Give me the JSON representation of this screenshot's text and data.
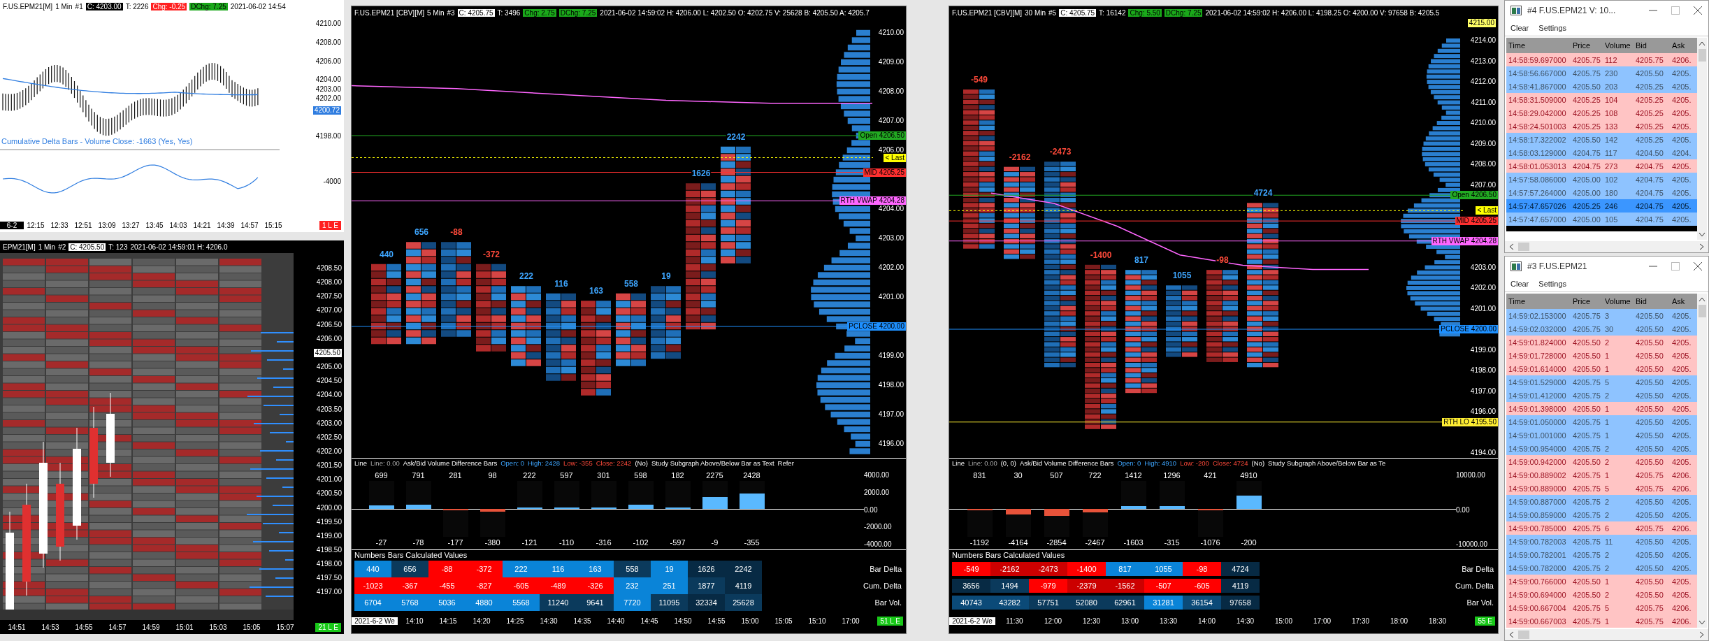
{
  "minute_chart": {
    "header": {
      "symbol": "F.US.EPM21[M]",
      "interval": "1 Min",
      "number": "#1",
      "close": "C: 4203.00",
      "trades": "T: 2226",
      "change": {
        "text": "Chg: -0.25",
        "kind": "down"
      },
      "daily_change": {
        "text": "DChg: 7.25",
        "kind": "up"
      },
      "details": "2021-06-02 14:54"
    },
    "price_labels": [
      {
        "text": "4210.00",
        "kind": "plain"
      },
      {
        "text": "4208.00",
        "kind": "plain"
      },
      {
        "text": "4206.00",
        "kind": "plain"
      },
      {
        "text": "4204.00",
        "kind": "plain"
      },
      {
        "text": "4203.00",
        "kind": "plain"
      },
      {
        "text": "4202.00",
        "kind": "plain"
      },
      {
        "text": "4200.72",
        "kind": "current"
      },
      {
        "text": "4198.00",
        "kind": "plain"
      }
    ],
    "study_label": "Cumulative Delta Bars - Volume  Close: -1663  (Yes, Yes)",
    "study_axis_label": "-4000",
    "time_labels": [
      {
        "text": "6-2",
        "kind": "date"
      },
      {
        "text": "12:15",
        "kind": "time"
      },
      {
        "text": "12:33",
        "kind": "time"
      },
      {
        "text": "12:51",
        "kind": "time"
      },
      {
        "text": "13:09",
        "kind": "time"
      },
      {
        "text": "13:27",
        "kind": "time"
      },
      {
        "text": "13:45",
        "kind": "time"
      },
      {
        "text": "14:03",
        "kind": "time"
      },
      {
        "text": "14:21",
        "kind": "time"
      },
      {
        "text": "14:39",
        "kind": "time"
      },
      {
        "text": "14:57",
        "kind": "time"
      },
      {
        "text": "15:15",
        "kind": "time"
      }
    ],
    "badge": {
      "text": "1 L E",
      "kind": "red"
    }
  },
  "minute_footprint": {
    "header": {
      "symbol": "EPM21[M]",
      "interval": "1 Min",
      "number": "#2",
      "close": "C: 4205.50",
      "trades": "T: 123",
      "details": "2021-06-02 14:59:01 H: 4206.0"
    },
    "price_labels": [
      {
        "text": "4208.50",
        "kind": "plain"
      },
      {
        "text": "4208.00",
        "kind": "plain"
      },
      {
        "text": "4207.50",
        "kind": "plain"
      },
      {
        "text": "4207.00",
        "kind": "plain"
      },
      {
        "text": "4206.50",
        "kind": "plain"
      },
      {
        "text": "4206.00",
        "kind": "plain"
      },
      {
        "text": "4205.50",
        "kind": "current"
      },
      {
        "text": "4205.00",
        "kind": "plain"
      },
      {
        "text": "4204.50",
        "kind": "plain"
      },
      {
        "text": "4204.00",
        "kind": "plain"
      },
      {
        "text": "4203.50",
        "kind": "plain"
      },
      {
        "text": "4203.00",
        "kind": "plain"
      },
      {
        "text": "4202.50",
        "kind": "plain"
      },
      {
        "text": "4202.00",
        "kind": "plain"
      },
      {
        "text": "4201.50",
        "kind": "plain"
      },
      {
        "text": "4201.00",
        "kind": "plain"
      },
      {
        "text": "4200.50",
        "kind": "plain"
      },
      {
        "text": "4200.00",
        "kind": "plain"
      },
      {
        "text": "4199.50",
        "kind": "plain"
      },
      {
        "text": "4199.00",
        "kind": "plain"
      },
      {
        "text": "4198.50",
        "kind": "plain"
      },
      {
        "text": "4198.00",
        "kind": "plain"
      },
      {
        "text": "4197.50",
        "kind": "plain"
      },
      {
        "text": "4197.00",
        "kind": "plain"
      }
    ],
    "time_labels": [
      "14:51",
      "14:53",
      "14:55",
      "14:57",
      "14:59",
      "15:01",
      "15:03",
      "15:05",
      "15:07"
    ],
    "badge": {
      "text": "21 L E",
      "kind": "green"
    }
  },
  "charts": [
    {
      "header": {
        "symbol": "F.US.EPM21 [CBV][M]",
        "interval": "5 Min",
        "number": "#3",
        "close": "C: 4205.75",
        "trades": "T: 3496",
        "change": {
          "text": "Chg: 2.75",
          "kind": "up"
        },
        "daily_change": {
          "text": "DChg: 7.25",
          "kind": "up"
        },
        "details": "2021-06-02 14:59:02 H: 4206.00 L: 4202.50 O: 4202.75 V: 25628 B: 4205.50 A: 4205.7"
      },
      "bar_deltas": [
        {
          "text": "440",
          "kind": "positive"
        },
        {
          "text": "656",
          "kind": "positive"
        },
        {
          "text": "-88",
          "kind": "negative"
        },
        {
          "text": "-372",
          "kind": "negative"
        },
        {
          "text": "222",
          "kind": "positive"
        },
        {
          "text": "116",
          "kind": "positive"
        },
        {
          "text": "163",
          "kind": "positive"
        },
        {
          "text": "558",
          "kind": "positive"
        },
        {
          "text": "19",
          "kind": "positive"
        },
        {
          "text": "1626",
          "kind": "positive"
        },
        {
          "text": "2242",
          "kind": "positive"
        }
      ],
      "price_labels": [
        {
          "text": "4210.00",
          "kind": "plain"
        },
        {
          "text": "4209.00",
          "kind": "plain"
        },
        {
          "text": "4208.00",
          "kind": "plain"
        },
        {
          "text": "4207.00",
          "kind": "plain"
        },
        {
          "text": "4206.00",
          "kind": "plain"
        },
        {
          "text": "4204.00",
          "kind": "plain"
        },
        {
          "text": "4203.00",
          "kind": "plain"
        },
        {
          "text": "4202.00",
          "kind": "plain"
        },
        {
          "text": "4201.00",
          "kind": "plain"
        },
        {
          "text": "4199.00",
          "kind": "plain"
        },
        {
          "text": "4198.00",
          "kind": "plain"
        },
        {
          "text": "4197.00",
          "kind": "plain"
        },
        {
          "text": "4196.00",
          "kind": "plain"
        }
      ],
      "markers": [
        {
          "label": "Open",
          "price": "4206.50",
          "color": "#22aa22"
        },
        {
          "label": "< Last",
          "color": "#ffff00"
        },
        {
          "label": "MID",
          "price": "4205.25",
          "color": "#ff3030"
        },
        {
          "label": "RTH VWAP",
          "price": "4204.28",
          "color": "#ff66ff"
        },
        {
          "label": "PCLOSE",
          "price": "4200.00",
          "color": "#1e90ff"
        }
      ],
      "study": {
        "header": [
          {
            "text": "Line",
            "kind": "name"
          },
          {
            "text": "Line: 0.00",
            "kind": "value"
          },
          {
            "text": "Ask/Bid Volume Difference Bars",
            "kind": "name"
          },
          {
            "text": "Open: 0",
            "kind": "up"
          },
          {
            "text": "High: 2428",
            "kind": "up"
          },
          {
            "text": "Low: -355",
            "kind": "down"
          },
          {
            "text": "Close: 2242",
            "kind": "down"
          },
          {
            "text": "(No)",
            "kind": "name"
          },
          {
            "text": "Study Subgraph Above/Below Bar as Text",
            "kind": "name"
          },
          {
            "text": "Refer",
            "kind": "name"
          }
        ],
        "axis_labels": [
          "4000.00",
          "2000.00",
          "0.00",
          "-2000.00",
          "-4000.00"
        ],
        "bars": [
          {
            "high": "699",
            "low": "-27",
            "kind": "up",
            "level": 0.12
          },
          {
            "high": "791",
            "low": "-78",
            "kind": "up",
            "level": 0.15
          },
          {
            "high": "281",
            "low": "-177",
            "kind": "down",
            "level": 0.05
          },
          {
            "high": "98",
            "low": "-380",
            "kind": "down",
            "level": 0.09
          },
          {
            "high": "222",
            "low": "-121",
            "kind": "up",
            "level": 0.06
          },
          {
            "high": "597",
            "low": "-110",
            "kind": "up",
            "level": 0.03
          },
          {
            "high": "301",
            "low": "-316",
            "kind": "up",
            "level": 0.03
          },
          {
            "high": "598",
            "low": "-102",
            "kind": "up",
            "level": 0.14
          },
          {
            "high": "182",
            "low": "-597",
            "kind": "up",
            "level": 0.01
          },
          {
            "high": "2275",
            "low": "-9",
            "kind": "up",
            "level": 0.42
          },
          {
            "high": "2428",
            "low": "-355",
            "kind": "up",
            "level": 0.55
          }
        ]
      },
      "table": {
        "title": "Numbers Bars Calculated Values",
        "rows": [
          {
            "label": "Bar Delta",
            "cells": [
              {
                "text": "440",
                "color": "#0a84d8"
              },
              {
                "text": "656",
                "color": "#0b3a5c"
              },
              {
                "text": "-88",
                "color": "#ff0000"
              },
              {
                "text": "-372",
                "color": "#ff0000"
              },
              {
                "text": "222",
                "color": "#0a84d8"
              },
              {
                "text": "116",
                "color": "#0a84d8"
              },
              {
                "text": "163",
                "color": "#0a84d8"
              },
              {
                "text": "558",
                "color": "#0b3a5c"
              },
              {
                "text": "19",
                "color": "#0a84d8"
              },
              {
                "text": "1626",
                "color": "#072a44"
              },
              {
                "text": "2242",
                "color": "#072a44"
              }
            ]
          },
          {
            "label": "Cum. Delta",
            "cells": [
              {
                "text": "-1023",
                "color": "#ff0000"
              },
              {
                "text": "-367",
                "color": "#ff0000"
              },
              {
                "text": "-455",
                "color": "#ff0000"
              },
              {
                "text": "-827",
                "color": "#ff0000"
              },
              {
                "text": "-605",
                "color": "#ff0000"
              },
              {
                "text": "-489",
                "color": "#ff0000"
              },
              {
                "text": "-326",
                "color": "#ff0000"
              },
              {
                "text": "232",
                "color": "#0a84d8"
              },
              {
                "text": "251",
                "color": "#0a84d8"
              },
              {
                "text": "1877",
                "color": "#0b3a5c"
              },
              {
                "text": "4119",
                "color": "#072a44"
              }
            ]
          },
          {
            "label": "Bar Vol.",
            "cells": [
              {
                "text": "6704",
                "color": "#0a84d8"
              },
              {
                "text": "5768",
                "color": "#0a84d8"
              },
              {
                "text": "5036",
                "color": "#0a84d8"
              },
              {
                "text": "4880",
                "color": "#0a84d8"
              },
              {
                "text": "5568",
                "color": "#0a84d8"
              },
              {
                "text": "11240",
                "color": "#0b3a5c"
              },
              {
                "text": "9641",
                "color": "#0b3a5c"
              },
              {
                "text": "7720",
                "color": "#0a84d8"
              },
              {
                "text": "11095",
                "color": "#0b3a5c"
              },
              {
                "text": "32334",
                "color": "#072a44"
              },
              {
                "text": "25628",
                "color": "#0b3a5c"
              }
            ]
          }
        ]
      },
      "time_labels": [
        {
          "text": "2021-6-2 We",
          "kind": "date"
        },
        {
          "text": "14:10",
          "kind": "time"
        },
        {
          "text": "14:15",
          "kind": "time"
        },
        {
          "text": "14:20",
          "kind": "time"
        },
        {
          "text": "14:25",
          "kind": "time"
        },
        {
          "text": "14:30",
          "kind": "time"
        },
        {
          "text": "14:35",
          "kind": "time"
        },
        {
          "text": "14:40",
          "kind": "time"
        },
        {
          "text": "14:45",
          "kind": "time"
        },
        {
          "text": "14:50",
          "kind": "time"
        },
        {
          "text": "14:55",
          "kind": "time"
        },
        {
          "text": "15:00",
          "kind": "time"
        },
        {
          "text": "15:05",
          "kind": "time"
        },
        {
          "text": "15:10",
          "kind": "time"
        },
        {
          "text": "17:00",
          "kind": "time"
        }
      ],
      "badge": {
        "text": "51 L E",
        "kind": "green"
      }
    },
    {
      "header": {
        "symbol": "F.US.EPM21 [CBV][M]",
        "interval": "30 Min",
        "number": "#5",
        "close": "C: 4205.75",
        "trades": "T: 16142",
        "change": {
          "text": "Chg: 5.50",
          "kind": "up"
        },
        "daily_change": {
          "text": "DChg: 7.25",
          "kind": "up"
        },
        "details": "2021-06-02 14:59:02 H: 4206.00 L: 4198.25 O: 4200.00 V: 97658 B: 4205.5"
      },
      "bar_deltas": [
        {
          "text": "-549",
          "kind": "negative"
        },
        {
          "text": "-2162",
          "kind": "negative"
        },
        {
          "text": "-2473",
          "kind": "negative"
        },
        {
          "text": "-1400",
          "kind": "negative"
        },
        {
          "text": "817",
          "kind": "positive"
        },
        {
          "text": "1055",
          "kind": "positive"
        },
        {
          "text": "-98",
          "kind": "negative"
        },
        {
          "text": "4724",
          "kind": "positive"
        }
      ],
      "price_labels": [
        {
          "text": "4215.00",
          "kind": "current"
        },
        {
          "text": "4214.00",
          "kind": "plain"
        },
        {
          "text": "4213.00",
          "kind": "plain"
        },
        {
          "text": "4212.00",
          "kind": "plain"
        },
        {
          "text": "4211.00",
          "kind": "plain"
        },
        {
          "text": "4210.00",
          "kind": "plain"
        },
        {
          "text": "4209.00",
          "kind": "plain"
        },
        {
          "text": "4208.00",
          "kind": "plain"
        },
        {
          "text": "4207.00",
          "kind": "plain"
        },
        {
          "text": "4203.00",
          "kind": "plain"
        },
        {
          "text": "4202.00",
          "kind": "plain"
        },
        {
          "text": "4201.00",
          "kind": "plain"
        },
        {
          "text": "4199.00",
          "kind": "plain"
        },
        {
          "text": "4198.00",
          "kind": "plain"
        },
        {
          "text": "4197.00",
          "kind": "plain"
        },
        {
          "text": "4196.00",
          "kind": "plain"
        },
        {
          "text": "4194.00",
          "kind": "plain"
        }
      ],
      "markers": [
        {
          "label": "Open",
          "price": "4206.50",
          "color": "#22aa22"
        },
        {
          "label": "< Last",
          "color": "#ffff00"
        },
        {
          "label": "MID",
          "price": "4205.25",
          "color": "#ff3030"
        },
        {
          "label": "RTH VWAP",
          "price": "4204.28",
          "color": "#ff66ff"
        },
        {
          "label": "PCLOSE",
          "price": "4200.00",
          "color": "#1e90ff"
        },
        {
          "label": "RTH LO",
          "price": "4195.50",
          "color": "#ffee33"
        }
      ],
      "study": {
        "header": [
          {
            "text": "Line",
            "kind": "name"
          },
          {
            "text": "Line: 0.00",
            "kind": "value"
          },
          {
            "text": "(0, 0)",
            "kind": "name"
          },
          {
            "text": "Ask/Bid Volume Difference Bars",
            "kind": "name"
          },
          {
            "text": "Open: 0",
            "kind": "up"
          },
          {
            "text": "High: 4910",
            "kind": "up"
          },
          {
            "text": "Low: -200",
            "kind": "down"
          },
          {
            "text": "Close: 4724",
            "kind": "down"
          },
          {
            "text": "(No)",
            "kind": "name"
          },
          {
            "text": "Study Subgraph Above/Below Bar as Te",
            "kind": "name"
          }
        ],
        "axis_labels": [
          "10000.00",
          "0.00",
          "-10000.00"
        ],
        "bars": [
          {
            "high": "831",
            "low": "-1192",
            "kind": "down",
            "level": 0.06
          },
          {
            "high": "30",
            "low": "-4164",
            "kind": "down",
            "level": 0.2
          },
          {
            "high": "507",
            "low": "-2854",
            "kind": "down",
            "level": 0.24
          },
          {
            "high": "722",
            "low": "-2467",
            "kind": "down",
            "level": 0.12
          },
          {
            "high": "1412",
            "low": "-1603",
            "kind": "up",
            "level": 0.09
          },
          {
            "high": "1296",
            "low": "-315",
            "kind": "up",
            "level": 0.1
          },
          {
            "high": "421",
            "low": "-1076",
            "kind": "down",
            "level": 0.03
          },
          {
            "high": "4910",
            "low": "-200",
            "kind": "up",
            "level": 0.47
          }
        ]
      },
      "table": {
        "title": "Numbers Bars Calculated Values",
        "rows": [
          {
            "label": "Bar Delta",
            "cells": [
              {
                "text": "-549",
                "color": "#ff0000"
              },
              {
                "text": "-2162",
                "color": "#cc0000"
              },
              {
                "text": "-2473",
                "color": "#cc0000"
              },
              {
                "text": "-1400",
                "color": "#ff0000"
              },
              {
                "text": "817",
                "color": "#0a84d8"
              },
              {
                "text": "1055",
                "color": "#0a84d8"
              },
              {
                "text": "-98",
                "color": "#ff0000"
              },
              {
                "text": "4724",
                "color": "#072a44"
              }
            ]
          },
          {
            "label": "Cum. Delta",
            "cells": [
              {
                "text": "3656",
                "color": "#072a44"
              },
              {
                "text": "1494",
                "color": "#0b3a5c"
              },
              {
                "text": "-979",
                "color": "#ff0000"
              },
              {
                "text": "-2379",
                "color": "#cc0000"
              },
              {
                "text": "-1562",
                "color": "#cc0000"
              },
              {
                "text": "-507",
                "color": "#ff0000"
              },
              {
                "text": "-605",
                "color": "#ff0000"
              },
              {
                "text": "4119",
                "color": "#072a44"
              }
            ]
          },
          {
            "label": "Bar Vol.",
            "cells": [
              {
                "text": "40743",
                "color": "#0b4a78"
              },
              {
                "text": "43282",
                "color": "#0b4a78"
              },
              {
                "text": "57751",
                "color": "#0b3a5c"
              },
              {
                "text": "52080",
                "color": "#0b3a5c"
              },
              {
                "text": "62961",
                "color": "#0b3a5c"
              },
              {
                "text": "31281",
                "color": "#0a84d8"
              },
              {
                "text": "36154",
                "color": "#0b4a78"
              },
              {
                "text": "97658",
                "color": "#072a44"
              }
            ]
          }
        ]
      },
      "time_labels": [
        {
          "text": "2021-6-2 We",
          "kind": "date"
        },
        {
          "text": "11:30",
          "kind": "time"
        },
        {
          "text": "12:00",
          "kind": "time"
        },
        {
          "text": "12:30",
          "kind": "time"
        },
        {
          "text": "13:00",
          "kind": "time"
        },
        {
          "text": "13:30",
          "kind": "time"
        },
        {
          "text": "14:00",
          "kind": "time"
        },
        {
          "text": "14:30",
          "kind": "time"
        },
        {
          "text": "15:00",
          "kind": "time"
        },
        {
          "text": "17:00",
          "kind": "time"
        },
        {
          "text": "17:30",
          "kind": "time"
        },
        {
          "text": "18:00",
          "kind": "time"
        },
        {
          "text": "18:30",
          "kind": "time"
        }
      ],
      "badge": {
        "text": "55 E",
        "kind": "green"
      }
    }
  ],
  "time_and_sales": [
    {
      "title": "#4 F.US.EPM21  V: 10...",
      "menu": [
        "Clear",
        "Settings"
      ],
      "columns": [
        "Time",
        "Price",
        "Volume",
        "Bid",
        "Ask"
      ],
      "rows": [
        {
          "time": "14:58:59.697000",
          "price": "4205.75",
          "volume": "112",
          "bid": "4205.75",
          "ask": "4206.",
          "kind": "sell",
          "selected": false
        },
        {
          "time": "14:58:56.667000",
          "price": "4205.75",
          "volume": "230",
          "bid": "4205.50",
          "ask": "4205.",
          "kind": "buy",
          "selected": false
        },
        {
          "time": "14:58:41.867000",
          "price": "4205.50",
          "volume": "203",
          "bid": "4205.25",
          "ask": "4205.",
          "kind": "buy",
          "selected": false
        },
        {
          "time": "14:58:31.509000",
          "price": "4205.25",
          "volume": "104",
          "bid": "4205.25",
          "ask": "4205.",
          "kind": "sell",
          "selected": false
        },
        {
          "time": "14:58:29.042000",
          "price": "4205.25",
          "volume": "108",
          "bid": "4205.25",
          "ask": "4205.",
          "kind": "sell",
          "selected": false
        },
        {
          "time": "14:58:24.501003",
          "price": "4205.25",
          "volume": "133",
          "bid": "4205.25",
          "ask": "4205.",
          "kind": "sell",
          "selected": false
        },
        {
          "time": "14:58:17.322002",
          "price": "4205.50",
          "volume": "142",
          "bid": "4205.25",
          "ask": "4205.",
          "kind": "buy",
          "selected": false
        },
        {
          "time": "14:58:03.129000",
          "price": "4204.75",
          "volume": "117",
          "bid": "4204.50",
          "ask": "4204.",
          "kind": "buy",
          "selected": false
        },
        {
          "time": "14:58:01.053013",
          "price": "4204.75",
          "volume": "273",
          "bid": "4204.75",
          "ask": "4205.",
          "kind": "sell",
          "selected": false
        },
        {
          "time": "14:57:58.086000",
          "price": "4205.00",
          "volume": "102",
          "bid": "4204.75",
          "ask": "4205.",
          "kind": "buy",
          "selected": false
        },
        {
          "time": "14:57:57.264000",
          "price": "4205.00",
          "volume": "180",
          "bid": "4204.75",
          "ask": "4205.",
          "kind": "buy",
          "selected": false
        },
        {
          "time": "14:57:47.657026",
          "price": "4205.25",
          "volume": "246",
          "bid": "4204.75",
          "ask": "4205.",
          "kind": "buy",
          "selected": true
        },
        {
          "time": "14:57:47.657000",
          "price": "4205.00",
          "volume": "105",
          "bid": "4204.75",
          "ask": "4205.",
          "kind": "buy",
          "selected": false
        }
      ]
    },
    {
      "title": "#3 F.US.EPM21",
      "menu": [
        "Clear",
        "Settings"
      ],
      "columns": [
        "Time",
        "Price",
        "Volume",
        "Bid",
        "Ask"
      ],
      "rows": [
        {
          "time": "14:59:02.153000",
          "price": "4205.75",
          "volume": "3",
          "bid": "4205.50",
          "ask": "4205.",
          "kind": "buy",
          "selected": false
        },
        {
          "time": "14:59:02.032000",
          "price": "4205.75",
          "volume": "30",
          "bid": "4205.50",
          "ask": "4205.",
          "kind": "buy",
          "selected": false
        },
        {
          "time": "14:59:01.824000",
          "price": "4205.50",
          "volume": "2",
          "bid": "4205.50",
          "ask": "4205.",
          "kind": "sell",
          "selected": false
        },
        {
          "time": "14:59:01.728000",
          "price": "4205.50",
          "volume": "1",
          "bid": "4205.50",
          "ask": "4205.",
          "kind": "sell",
          "selected": false
        },
        {
          "time": "14:59:01.614000",
          "price": "4205.50",
          "volume": "1",
          "bid": "4205.50",
          "ask": "4205.",
          "kind": "sell",
          "selected": false
        },
        {
          "time": "14:59:01.529000",
          "price": "4205.75",
          "volume": "5",
          "bid": "4205.50",
          "ask": "4205.",
          "kind": "buy",
          "selected": false
        },
        {
          "time": "14:59:01.412000",
          "price": "4205.75",
          "volume": "2",
          "bid": "4205.50",
          "ask": "4205.",
          "kind": "buy",
          "selected": false
        },
        {
          "time": "14:59:01.398000",
          "price": "4205.50",
          "volume": "1",
          "bid": "4205.50",
          "ask": "4205.",
          "kind": "sell",
          "selected": false
        },
        {
          "time": "14:59:01.050000",
          "price": "4205.75",
          "volume": "1",
          "bid": "4205.50",
          "ask": "4205.",
          "kind": "buy",
          "selected": false
        },
        {
          "time": "14:59:01.001000",
          "price": "4205.75",
          "volume": "1",
          "bid": "4205.50",
          "ask": "4205.",
          "kind": "buy",
          "selected": false
        },
        {
          "time": "14:59:00.954000",
          "price": "4205.75",
          "volume": "2",
          "bid": "4205.50",
          "ask": "4205.",
          "kind": "buy",
          "selected": false
        },
        {
          "time": "14:59:00.942000",
          "price": "4205.50",
          "volume": "2",
          "bid": "4205.50",
          "ask": "4205.",
          "kind": "sell",
          "selected": false
        },
        {
          "time": "14:59:00.889002",
          "price": "4205.75",
          "volume": "1",
          "bid": "4205.75",
          "ask": "4206.",
          "kind": "sell",
          "selected": false
        },
        {
          "time": "14:59:00.889000",
          "price": "4205.75",
          "volume": "5",
          "bid": "4205.75",
          "ask": "4206.",
          "kind": "sell",
          "selected": false
        },
        {
          "time": "14:59:00.887000",
          "price": "4205.75",
          "volume": "2",
          "bid": "4205.50",
          "ask": "4205.",
          "kind": "buy",
          "selected": false
        },
        {
          "time": "14:59:00.859000",
          "price": "4205.75",
          "volume": "2",
          "bid": "4205.50",
          "ask": "4205.",
          "kind": "buy",
          "selected": false
        },
        {
          "time": "14:59:00.785000",
          "price": "4205.75",
          "volume": "6",
          "bid": "4205.75",
          "ask": "4206.",
          "kind": "sell",
          "selected": false
        },
        {
          "time": "14:59:00.782003",
          "price": "4205.75",
          "volume": "11",
          "bid": "4205.50",
          "ask": "4205.",
          "kind": "buy",
          "selected": false
        },
        {
          "time": "14:59:00.782001",
          "price": "4205.75",
          "volume": "2",
          "bid": "4205.50",
          "ask": "4205.",
          "kind": "buy",
          "selected": false
        },
        {
          "time": "14:59:00.782000",
          "price": "4205.75",
          "volume": "2",
          "bid": "4205.50",
          "ask": "4205.",
          "kind": "buy",
          "selected": false
        },
        {
          "time": "14:59:00.766000",
          "price": "4205.50",
          "volume": "1",
          "bid": "4205.50",
          "ask": "4205.",
          "kind": "sell",
          "selected": false
        },
        {
          "time": "14:59:00.694000",
          "price": "4205.50",
          "volume": "2",
          "bid": "4205.50",
          "ask": "4205.",
          "kind": "sell",
          "selected": false
        },
        {
          "time": "14:59:00.667004",
          "price": "4205.75",
          "volume": "5",
          "bid": "4205.75",
          "ask": "4206.",
          "kind": "sell",
          "selected": false
        },
        {
          "time": "14:59:00.667003",
          "price": "4205.75",
          "volume": "1",
          "bid": "4205.75",
          "ask": "4206.",
          "kind": "sell",
          "selected": false
        }
      ]
    }
  ]
}
